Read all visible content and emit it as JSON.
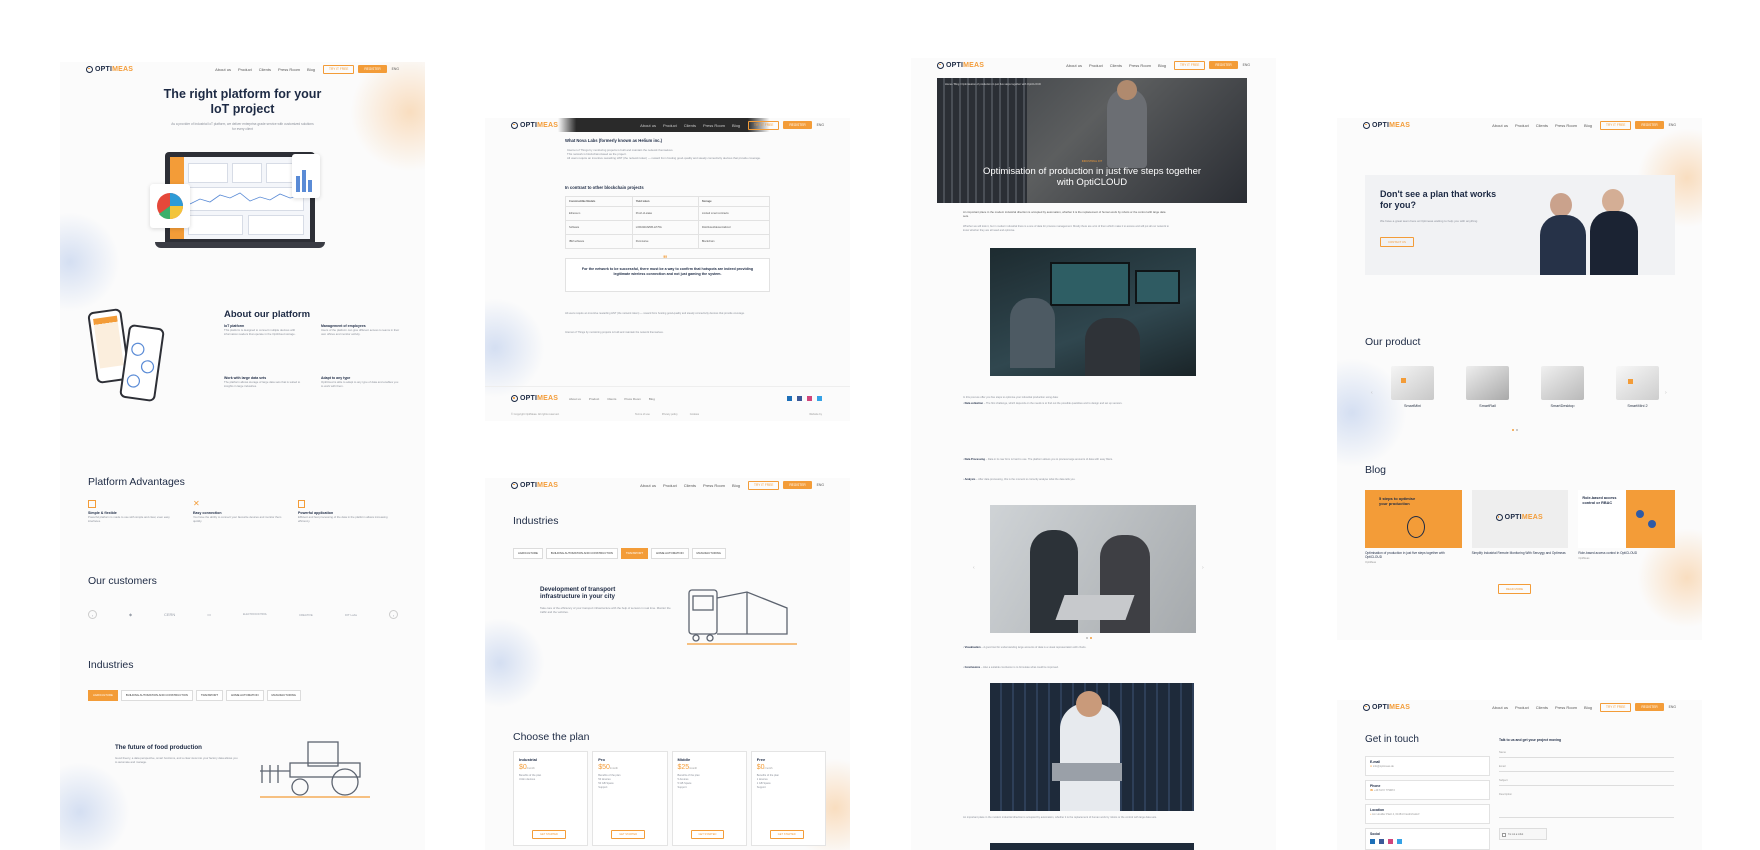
{
  "brand": {
    "logo_prefix": "OPTI",
    "logo_accent": "MEAS",
    "accent_color": "#f39c38",
    "navy": "#1d2a44"
  },
  "nav": {
    "links": [
      "About us",
      "Product",
      "Clients",
      "Press Room",
      "Blog"
    ],
    "try_button": "TRY IT FREE",
    "primary_button": "REGISTER",
    "lang": "ENG"
  },
  "col1": {
    "hero_title": "The right platform for your IoT project",
    "hero_sub": "As a provider of Industrial IoT platform, we deliver enterprise-grade service with customized solutions for every client",
    "about": {
      "title": "About our platform",
      "items": [
        {
          "title": "IoT platform",
          "text": "This platform is designed to connect multiple devices with information readers that operate in the OptiCloud storage."
        },
        {
          "title": "Management of employees",
          "text": "Users of the platform can give different access to teams in their own offices and monitor activity."
        },
        {
          "title": "Work with large data sets",
          "text": "The platform allows storage of large data sets that is suited to insights in large industries."
        },
        {
          "title": "Adapt to any type",
          "text": "OptiCloud is able to adapt to any type of data and enables you to work with them."
        }
      ]
    },
    "advantages": {
      "title": "Platform Advantages",
      "items": [
        {
          "title": "Simple & flexible",
          "text": "Powerful platform is made to use with simple and clear, even easy interfaces."
        },
        {
          "title": "Easy connection",
          "text": "You have the ability to connect your favourite devices and monitor them quickly."
        },
        {
          "title": "Powerful application",
          "text": "Efficient and fast processing of the data in the platform allows increasing efficiency."
        }
      ]
    },
    "customers": {
      "title": "Our customers",
      "logos": [
        "◆",
        "CERN",
        "▭",
        "ELECTROCONTROL",
        "CREATIVE",
        "IOT Labs"
      ]
    },
    "industries": {
      "title": "Industries",
      "tabs": [
        "AGRICULTURE",
        "BUILDING AUTOMATION AND CONSTRUCTION",
        "TRANSPORT",
        "HOME AUTOMATION",
        "MANUFACTURING"
      ],
      "active_tab": 0,
      "feature_title": "The future of food production",
      "feature_text": "Good theory, a data perspective, smart functions, and a clear view into your factory data allows you to automate and manage."
    }
  },
  "col2": {
    "article_heading": "What Nova Labs (formerly known as Helium inc.)",
    "bullets": [
      "Internet of Things by monitoring projects is built and maintain the network themselves.",
      "This network is blockchain-based as the project.",
      "All users require an incentive rewarding HNT (the network token) — reward from hosting good-quality and steady connectivity devices that provide coverage."
    ],
    "comparison_title": "In contrast to other blockchain projects",
    "table": {
      "headers": [
        "Constructible Models",
        "Yield token",
        "Storage"
      ],
      "rows": [
        [
          "Ethereum",
          "Proof-of-stake",
          "Limited smart contracts"
        ],
        [
          "Software",
          "LORAWAN/NB-IoT/5G",
          "Distributed/decentralized"
        ],
        [
          "IBM software",
          "Permissive",
          "Blockchain"
        ]
      ]
    },
    "quote": "For the network to be successful, there must be a way to confirm that hotspots are indeed providing legitimate wireless connection and not just gaming the system.",
    "footer_links": [
      "About us",
      "Product",
      "Clients",
      "Press Room",
      "Blog"
    ],
    "copyright": "© Copyright OptiMeas. All rights reserved.",
    "footer_mid": [
      "Terms of use",
      "Privacy policy",
      "Cookies"
    ],
    "footer_right": "Website by",
    "industries": {
      "title": "Industries",
      "tabs": [
        "AGRICULTURE",
        "BUILDING AUTOMATION AND CONSTRUCTION",
        "TRANSPORT",
        "HOME AUTOMATION",
        "MANUFACTURING"
      ],
      "active_tab": 2,
      "feature_title": "Development of transport infrastructure in your city",
      "feature_text": "Take care of the efficiency of your transport infrastructure with the help of sensors in real time. Monitor the traffic and the vehicles."
    },
    "plans": {
      "title": "Choose the plan",
      "items": [
        {
          "name": "Industrial",
          "price": "$0",
          "unit": "/month",
          "features": [
            "Unlim devices"
          ]
        },
        {
          "name": "Pro",
          "price": "$50",
          "unit": "/month",
          "features": [
            "50 devices",
            "50 GB Space",
            "Support"
          ]
        },
        {
          "name": "Middle",
          "price": "$25",
          "unit": "/month",
          "features": [
            "5 devices",
            "5 GB Space",
            "Support"
          ]
        },
        {
          "name": "Free",
          "price": "$0",
          "unit": "/month",
          "features": [
            "1 devices",
            "1 GB Space",
            "Support"
          ]
        }
      ],
      "benefits_label": "Benefits of the plan",
      "button": "GET STARTED"
    }
  },
  "col3": {
    "breadcrumb": "Home / Blog / Optimisation of production in just five steps together with OptiCLOUD",
    "category": "INDUSTRIAL IOT",
    "title": "Optimisation of production in just five steps together with OptiCLOUD",
    "lead": "An important place in the modern industrial direction is occupied by automation, whether it is the replacement of human work by robots or the control with large data sets.",
    "intro": "Whether we will look it, but in modern industrial there is a one of data for process management. Mostly there are a lot of them which make it to access and will put all our network to know whether they are all need and optimise.",
    "para2": "In this post we offer you five steps to optimise your industrial production using data:",
    "item_data": "Data collection",
    "item_data_text": "The first challenge, which depends on the needs is to find out the possible quantities and to design and set up sensors.",
    "item_processing": "Data Processing",
    "item_processing_text": "Data in its raw form is hard to use. The platform allows you to process large amounts of data with easy filters.",
    "item_analysis": "Analysis",
    "item_analysis_text": "After data processing, this is the moment to correctly analyse what the data tells you.",
    "item_vis": "Visualisation",
    "item_vis_text": "A good tool for understanding large amounts of data is a visual representation with charts.",
    "item_conclusions": "Conclusions",
    "item_conclusions_text": "Also a suitable conclusion is to formulate what could be improved."
  },
  "col4": {
    "cta": {
      "title": "Don't see a plan that works for you?",
      "text": "We have a great team here at Optimeas waiting to help you with anything",
      "button": "CONTACT US"
    },
    "product": {
      "title": "Our product",
      "items": [
        "SmartMini",
        "SmartRail",
        "SmartDesktop",
        "SmartMini 2"
      ]
    },
    "blog": {
      "title": "Blog",
      "posts": [
        {
          "badge": "5 steps to optimise your production",
          "title": "Optimisation of production in just five steps together with OptiCLOUD",
          "meta": "OptiMeas"
        },
        {
          "badge": "",
          "title": "Simplify Industrial Remote Monitoring With Senzygy and Optimeas",
          "meta": ""
        },
        {
          "badge": "Role-based access control or RBAC",
          "title": "Role-based access control in OptiCLOUD",
          "meta": "OptiMeas"
        }
      ],
      "button": "READ MORE"
    },
    "contact": {
      "title": "Get in touch",
      "right_title": "Talk to us and get your project moving",
      "email_label": "E-mail",
      "email_value": "info@optimeas.de",
      "phone_label": "Phone",
      "phone_value": "+49 6172 77998 0",
      "location_label": "Location",
      "location_value": "Am Houiller Platz 4, 61381 Friedrichsdorf",
      "social_label": "Social",
      "fields": [
        "Name",
        "Email",
        "Subject",
        "Description"
      ],
      "checkbox": "I'm not a robot"
    }
  }
}
